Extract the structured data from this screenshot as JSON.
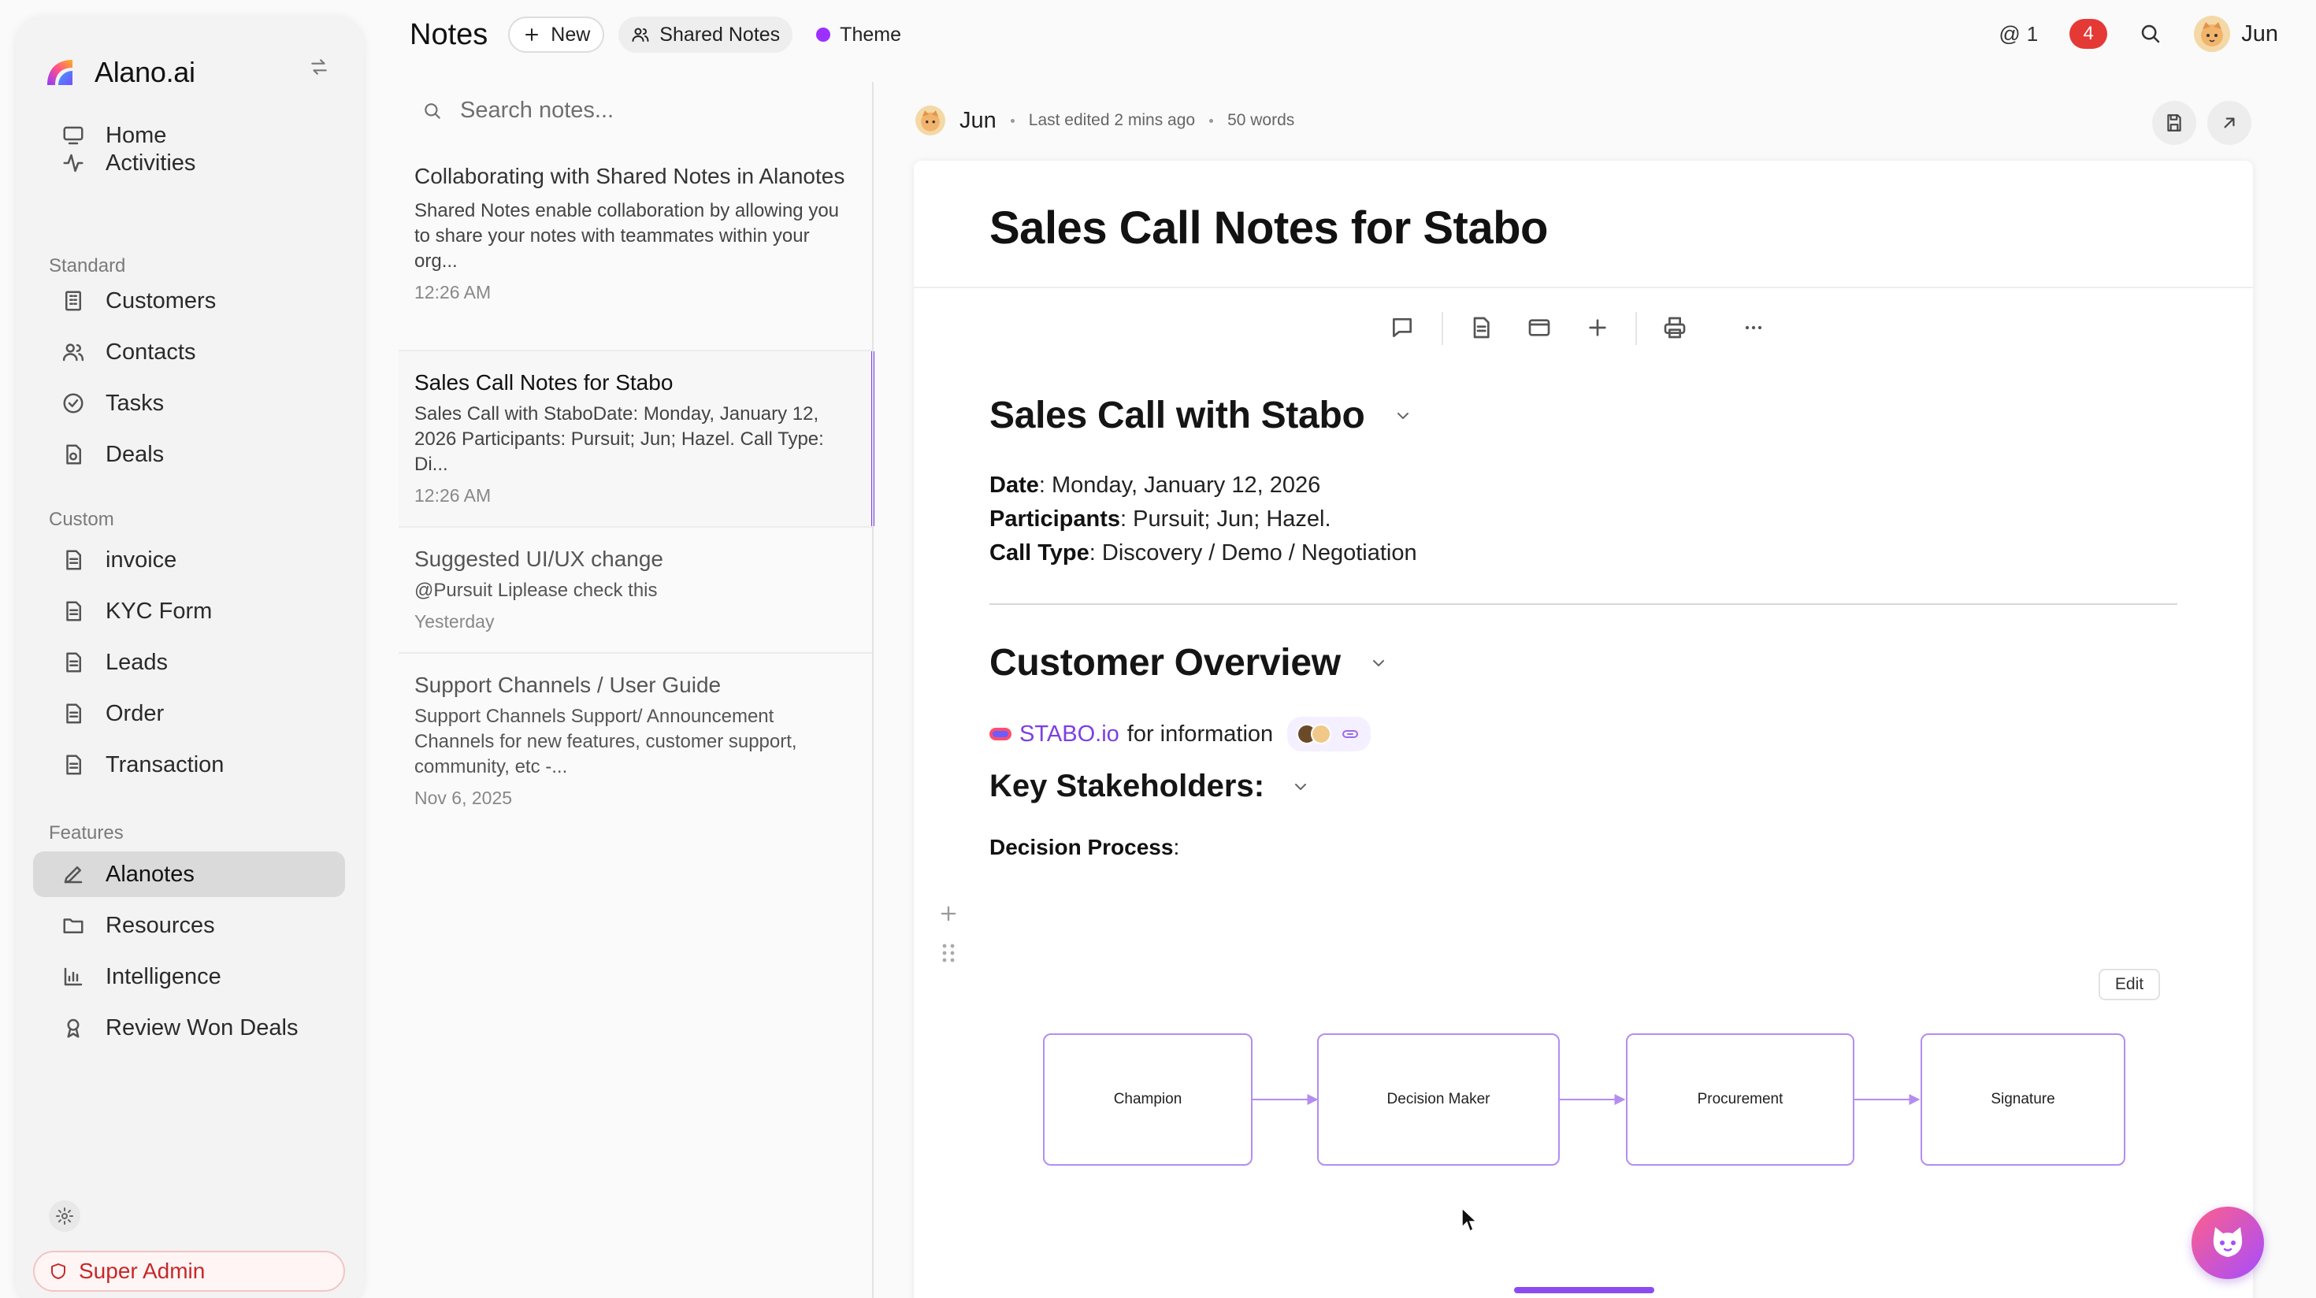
{
  "brand": {
    "name": "Alano.ai"
  },
  "sidebar": {
    "top_items": [
      {
        "label": "Home",
        "icon": "monitor-icon"
      },
      {
        "label": "Activities",
        "icon": "activity-icon"
      }
    ],
    "sections": {
      "standard": "Standard",
      "custom": "Custom",
      "features": "Features"
    },
    "standard_items": [
      {
        "label": "Customers",
        "icon": "building-icon"
      },
      {
        "label": "Contacts",
        "icon": "users-icon"
      },
      {
        "label": "Tasks",
        "icon": "check-circle-icon"
      },
      {
        "label": "Deals",
        "icon": "deal-file-icon"
      }
    ],
    "custom_items": [
      {
        "label": "invoice",
        "icon": "document-icon"
      },
      {
        "label": "KYC Form",
        "icon": "document-icon"
      },
      {
        "label": "Leads",
        "icon": "document-icon"
      },
      {
        "label": "Order",
        "icon": "document-icon"
      },
      {
        "label": "Transaction",
        "icon": "document-icon"
      }
    ],
    "feature_items": [
      {
        "label": "Alanotes",
        "icon": "pen-icon",
        "active": true
      },
      {
        "label": "Resources",
        "icon": "folder-icon"
      },
      {
        "label": "Intelligence",
        "icon": "bar-chart-icon"
      },
      {
        "label": "Review Won Deals",
        "icon": "award-icon"
      }
    ],
    "super_admin": "Super Admin"
  },
  "topbar": {
    "title": "Notes",
    "new_label": "New",
    "shared_label": "Shared Notes",
    "theme_label": "Theme",
    "theme_color": "#9b30ff",
    "mention_count": "1",
    "notification_count": "4",
    "user_name": "Jun"
  },
  "notes": {
    "search_placeholder": "Search notes...",
    "items": [
      {
        "title": "Collaborating with Shared Notes in Alanotes",
        "preview": "Shared Notes enable collaboration by allowing you to share your notes with teammates within your org...",
        "time": "12:26 AM"
      },
      {
        "title": "Sales Call Notes for Stabo",
        "preview": "Sales Call with StaboDate: Monday, January 12, 2026 Participants: Pursuit; Jun; Hazel. Call Type: Di...",
        "time": "12:26 AM"
      },
      {
        "title": "Suggested UI/UX change",
        "preview": "@Pursuit Liplease check this",
        "time": "Yesterday"
      },
      {
        "title": "Support Channels / User Guide",
        "preview": "Support Channels Support/ Announcement Channels for new features, customer support, community, etc -...",
        "time": "Nov 6, 2025"
      }
    ]
  },
  "editor": {
    "author": "Jun",
    "last_edited": "Last edited 2 mins ago",
    "word_count": "50 words",
    "title": "Sales Call Notes for Stabo",
    "heading1": "Sales Call with Stabo",
    "date_label": "Date",
    "date_value": ": Monday, January 12, 2026",
    "participants_label": "Participants",
    "participants_value": ": Pursuit; Jun; Hazel.",
    "call_type_label": "Call Type",
    "call_type_value": ": Discovery / Demo / Negotiation",
    "heading2": "Customer Overview",
    "stabo_link": "STABO.io",
    "stabo_suffix": "for information",
    "heading3": "Key Stakeholders:",
    "decision_label": "Decision Process",
    "decision_suffix": ":",
    "edit_label": "Edit",
    "flow_steps": [
      "Champion",
      "Decision Maker",
      "Procurement",
      "Signature"
    ],
    "accent_color": "#b48df0"
  }
}
